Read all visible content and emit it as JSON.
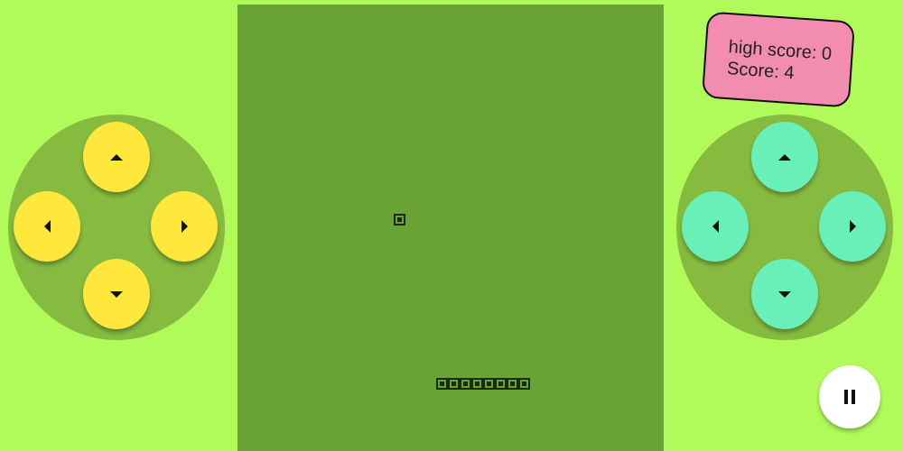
{
  "score_panel": {
    "high_score_text": "high score: 0",
    "score_text": "Score: 4"
  },
  "colors": {
    "background": "#b0fb5a",
    "board": "#6aa335",
    "pad": "#86bb40",
    "left_buttons": "#ffe73c",
    "right_buttons": "#68f0b8",
    "score_card": "#f28cb1",
    "snake": "#1a2a0b"
  },
  "controls": {
    "left_pad": [
      "up-arrow-icon",
      "left-arrow-icon",
      "right-arrow-icon",
      "down-arrow-icon"
    ],
    "right_pad": [
      "up-arrow-icon",
      "left-arrow-icon",
      "right-arrow-icon",
      "down-arrow-icon"
    ],
    "pause_icon": "pause-icon"
  }
}
